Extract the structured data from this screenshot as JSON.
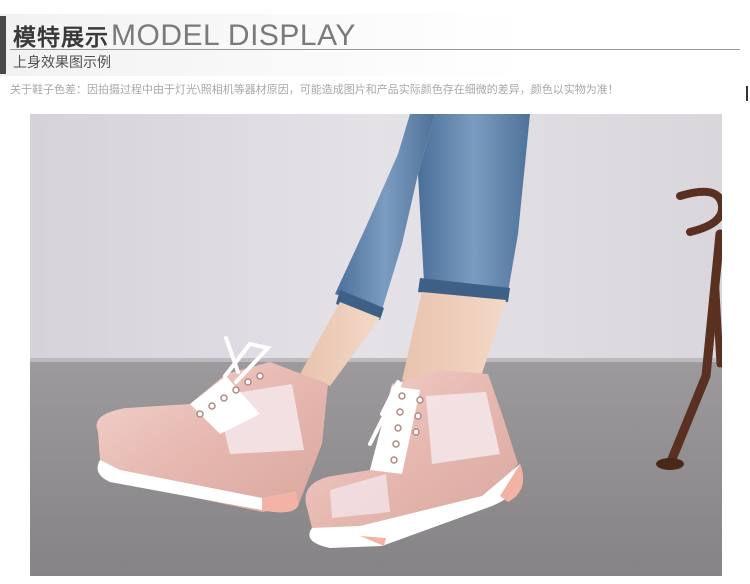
{
  "header": {
    "title_cn": "模特展示",
    "title_en": "MODEL DISPLAY",
    "subtitle": "上身效果图示例"
  },
  "notice": "关于鞋子色差：因拍摄过程中由于灯光\\照相机等器材原因，可能造成图片和产品实际颜色存在细微的差异，颜色以实物为准！",
  "photo": {
    "subject": "model wearing pink metallic lace-up wedge sneakers",
    "colors": {
      "wall": "#dcd8e0",
      "floor": "#8d8b8d",
      "shoe": "#e9c0ba",
      "jeans": "#5a7ea6"
    }
  }
}
